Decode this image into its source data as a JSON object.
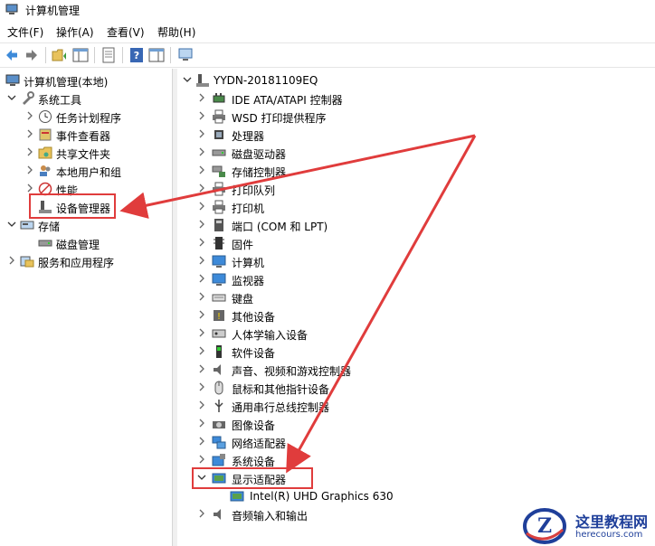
{
  "window": {
    "title": "计算机管理"
  },
  "menu": [
    "文件(F)",
    "操作(A)",
    "查看(V)",
    "帮助(H)"
  ],
  "toolbar": {
    "buttons": [
      "back-icon",
      "forward-icon",
      "up-folder-icon",
      "show-hide-tree-icon",
      "properties-icon",
      "help-icon",
      "action-pane-icon",
      "monitor-icon"
    ]
  },
  "left_tree": [
    {
      "label": "计算机管理(本地)",
      "icon": "computer-management-icon",
      "expand": "none"
    },
    {
      "label": "系统工具",
      "icon": "tools-icon",
      "expand": "expanded"
    },
    {
      "label": "任务计划程序",
      "icon": "clock-icon",
      "expand": "collapsed"
    },
    {
      "label": "事件查看器",
      "icon": "event-viewer-icon",
      "expand": "collapsed"
    },
    {
      "label": "共享文件夹",
      "icon": "shared-folder-icon",
      "expand": "collapsed"
    },
    {
      "label": "本地用户和组",
      "icon": "users-icon",
      "expand": "collapsed"
    },
    {
      "label": "性能",
      "icon": "performance-icon",
      "expand": "collapsed"
    },
    {
      "label": "设备管理器",
      "icon": "device-manager-icon",
      "expand": "none"
    },
    {
      "label": "存储",
      "icon": "storage-icon",
      "expand": "expanded"
    },
    {
      "label": "磁盘管理",
      "icon": "disk-icon",
      "expand": "none"
    },
    {
      "label": "服务和应用程序",
      "icon": "services-icon",
      "expand": "collapsed"
    }
  ],
  "device_tree": {
    "root": "YYDN-20181109EQ",
    "categories": [
      {
        "label": "IDE ATA/ATAPI 控制器",
        "icon": "ide-controller-icon"
      },
      {
        "label": "WSD 打印提供程序",
        "icon": "printer-icon"
      },
      {
        "label": "处理器",
        "icon": "cpu-icon"
      },
      {
        "label": "磁盘驱动器",
        "icon": "disk-drive-icon"
      },
      {
        "label": "存储控制器",
        "icon": "storage-controller-icon"
      },
      {
        "label": "打印队列",
        "icon": "printer-icon"
      },
      {
        "label": "打印机",
        "icon": "printer-icon"
      },
      {
        "label": "端口 (COM 和 LPT)",
        "icon": "port-icon"
      },
      {
        "label": "固件",
        "icon": "firmware-icon"
      },
      {
        "label": "计算机",
        "icon": "monitor-icon"
      },
      {
        "label": "监视器",
        "icon": "monitor-icon"
      },
      {
        "label": "键盘",
        "icon": "keyboard-icon"
      },
      {
        "label": "其他设备",
        "icon": "other-device-icon"
      },
      {
        "label": "人体学输入设备",
        "icon": "hid-icon"
      },
      {
        "label": "软件设备",
        "icon": "software-device-icon"
      },
      {
        "label": "声音、视频和游戏控制器",
        "icon": "speaker-icon"
      },
      {
        "label": "鼠标和其他指针设备",
        "icon": "mouse-icon"
      },
      {
        "label": "通用串行总线控制器",
        "icon": "usb-icon"
      },
      {
        "label": "图像设备",
        "icon": "camera-icon"
      },
      {
        "label": "网络适配器",
        "icon": "network-icon"
      },
      {
        "label": "系统设备",
        "icon": "system-device-icon"
      },
      {
        "label": "显示适配器",
        "icon": "display-adapter-icon",
        "expanded": true
      },
      {
        "label": "Intel(R) UHD Graphics 630",
        "icon": "display-adapter-icon",
        "child": true
      },
      {
        "label": "音频输入和输出",
        "icon": "speaker-icon"
      }
    ]
  },
  "annotation_color": "#e03c3c",
  "watermark": {
    "title": "这里教程网",
    "url": "herecours.com",
    "logo_letter": "Z"
  }
}
